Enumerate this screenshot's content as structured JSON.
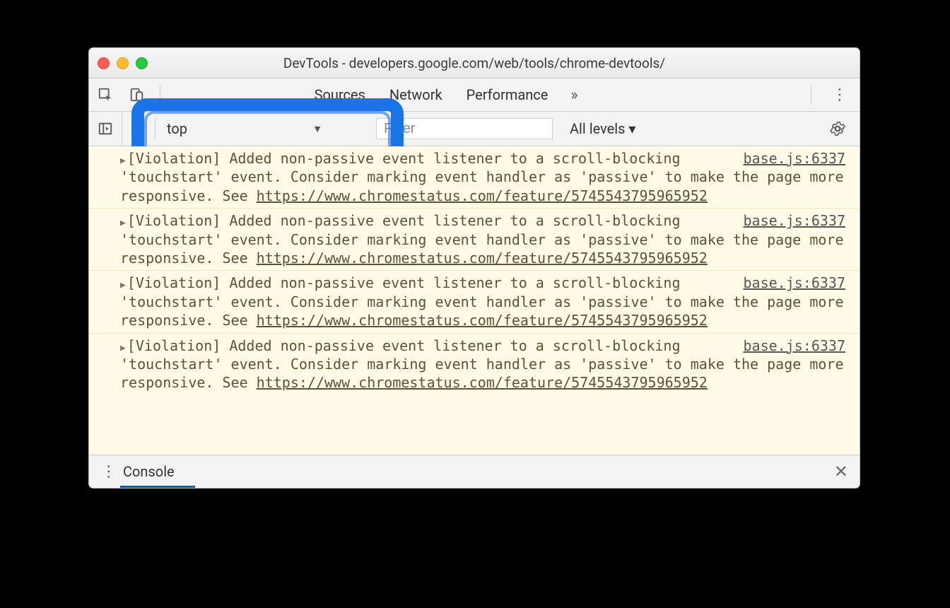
{
  "window": {
    "title": "DevTools - developers.google.com/web/tools/chrome-devtools/"
  },
  "tabs": {
    "visible": [
      "Sources",
      "Network",
      "Performance"
    ],
    "overflow_label": "»"
  },
  "console_toolbar": {
    "context": "top",
    "filter_placeholder": "Filter",
    "levels_label": "All levels ▾"
  },
  "drawer": {
    "label": "Console"
  },
  "message_template": {
    "text_a": "[Violation] Added non-passive event listener to a scroll-blocking 'touchstart' event. Consider marking event handler as 'passive' to make the page more responsive. See ",
    "link": "https://www.chromestatus.com/feature/5745543795965952",
    "source": "base.js:6337"
  },
  "messages": [
    0,
    1,
    2,
    3
  ]
}
